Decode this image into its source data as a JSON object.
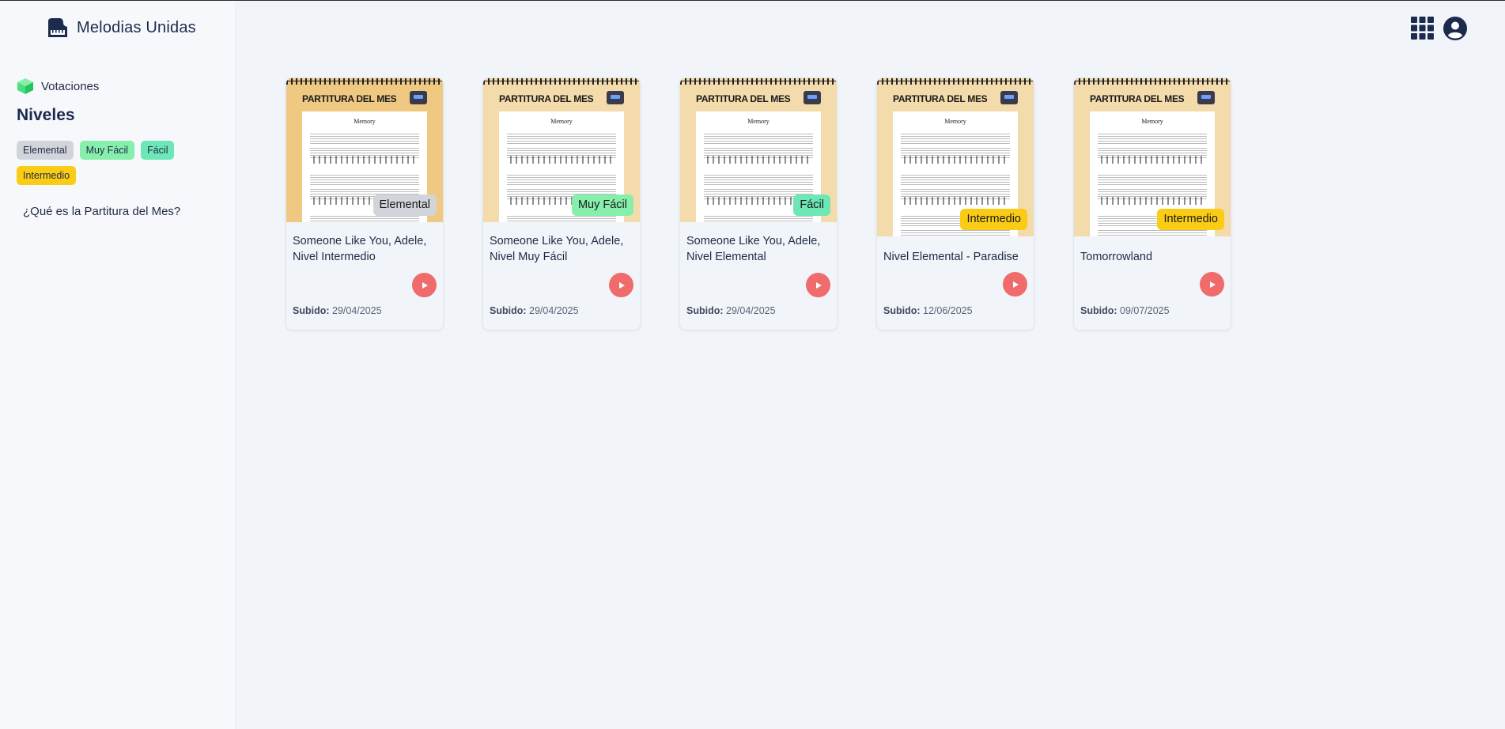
{
  "app": {
    "name": "Melodias Unidas"
  },
  "sidebar": {
    "votes_label": "Votaciones",
    "levels_title": "Niveles",
    "levels": [
      {
        "label": "Elemental",
        "color": "#d1d5db"
      },
      {
        "label": "Muy Fácil",
        "color": "#86efac"
      },
      {
        "label": "Fácil",
        "color": "#6ee7b7"
      },
      {
        "label": "Intermedio",
        "color": "#facc15"
      }
    ],
    "faq_label": "¿Qué es la Partitura del Mes?"
  },
  "header": {
    "icons": [
      "apps-grid-icon",
      "user-account-icon"
    ]
  },
  "cards": [
    {
      "thumb_heading": "PARTITURA DEL MES",
      "sheet_title": "Memory",
      "badge": "Elemental",
      "badge_color": "#d1d5db",
      "title": "Someone Like You, Adele, Nivel Intermedio",
      "uploaded_label": "Subido:",
      "uploaded_date": "29/04/2025"
    },
    {
      "thumb_heading": "PARTITURA DEL MES",
      "sheet_title": "Memory",
      "badge": "Muy Fácil",
      "badge_color": "#86efac",
      "title": "Someone Like You, Adele, Nivel Muy Fácil",
      "uploaded_label": "Subido:",
      "uploaded_date": "29/04/2025"
    },
    {
      "thumb_heading": "PARTITURA DEL MES",
      "sheet_title": "Memory",
      "badge": "Fácil",
      "badge_color": "#6ee7b7",
      "title": "Someone Like You, Adele, Nivel Elemental",
      "uploaded_label": "Subido:",
      "uploaded_date": "29/04/2025"
    },
    {
      "thumb_heading": "PARTITURA DEL MES",
      "sheet_title": "Memory",
      "badge": "Intermedio",
      "badge_color": "#facc15",
      "title": "Nivel Elemental - Paradise",
      "uploaded_label": "Subido:",
      "uploaded_date": "12/06/2025"
    },
    {
      "thumb_heading": "PARTITURA DEL MES",
      "sheet_title": "Memory",
      "badge": "Intermedio",
      "badge_color": "#facc15",
      "title": "Tomorrowland",
      "uploaded_label": "Subido:",
      "uploaded_date": "09/07/2025"
    }
  ]
}
